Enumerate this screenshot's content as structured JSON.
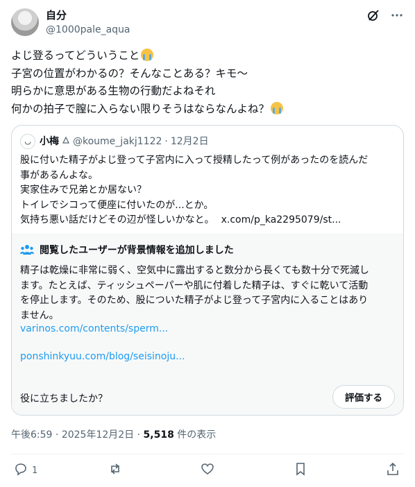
{
  "author": {
    "display_name": "自分",
    "handle": "@1000pale_aqua"
  },
  "tweet": {
    "lines": [
      "よじ登るってどういうこと",
      "子宮の位置がわかるの？そんなことある？キモ〜",
      "明らかに意思がある生物の行動だよねそれ",
      "何かの拍子で膣に入らない限りそうはならなんよね？"
    ],
    "emoji": "loudly-crying-face"
  },
  "quote": {
    "display_name": "小梅",
    "handle": "@koume_jakj1122",
    "separator": "·",
    "date": "12月2日",
    "lines": [
      "股に付いた精子がよじ登って子宮内に入って授精したって例があったのを読んだ",
      "事があるんよな。",
      "実家住みで兄弟とか居ない？",
      "トイレでシコって便座に付いたのが...とか。",
      "気持ち悪い話だけどその辺が怪しいかなと。"
    ],
    "link": "x.com/p_ka2295079/st..."
  },
  "community_note": {
    "title": "閲覧したユーザーが背景情報を追加しました",
    "lines": [
      "精子は乾燥に非常に弱く、空気中に露出すると数分から長くても数十分で死滅し",
      "ます。たとえば、ティッシュペーパーや肌に付着した精子は、すぐに乾いて活動",
      "を停止します。そのため、股についた精子がよじ登って子宮内に入ることはあり",
      "ません。"
    ],
    "links": [
      "varinos.com/contents/sperm...",
      "ponshinkyuu.com/blog/seisinoju..."
    ],
    "question": "役に立ちましたか？",
    "rate_label": "評価する"
  },
  "meta": {
    "time": "午後6:59",
    "sep1": "·",
    "date": "2025年12月2日",
    "sep2": "·",
    "views": "5,518",
    "views_suffix": "件の表示"
  },
  "actions": {
    "reply_count": "1"
  },
  "colors": {
    "link": "#1d9bf0",
    "secondary": "#536471",
    "border": "#cfd9de"
  }
}
